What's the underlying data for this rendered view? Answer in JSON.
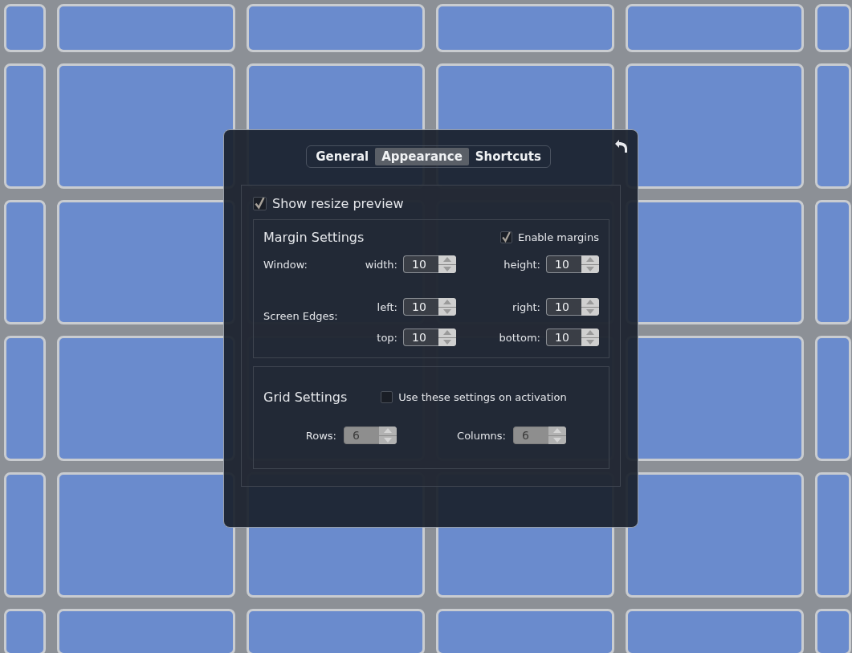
{
  "tabs": [
    {
      "label": "General",
      "selected": false
    },
    {
      "label": "Appearance",
      "selected": true
    },
    {
      "label": "Shortcuts",
      "selected": false
    }
  ],
  "show_resize_preview": {
    "label": "Show resize preview",
    "checked": true
  },
  "margin_settings": {
    "title": "Margin Settings",
    "enable_margins": {
      "label": "Enable margins",
      "checked": true
    },
    "window": {
      "label": "Window:",
      "fields": [
        {
          "label": "width:",
          "value": "10"
        },
        {
          "label": "height:",
          "value": "10"
        }
      ]
    },
    "screen_edges": {
      "label": "Screen Edges:",
      "fields": [
        {
          "label": "left:",
          "value": "10"
        },
        {
          "label": "right:",
          "value": "10"
        },
        {
          "label": "top:",
          "value": "10"
        },
        {
          "label": "bottom:",
          "value": "10"
        }
      ]
    }
  },
  "grid_settings": {
    "title": "Grid Settings",
    "use_on_activation": {
      "label": "Use these settings on activation",
      "checked": false
    },
    "fields": [
      {
        "label": "Rows:",
        "value": "6",
        "disabled": true
      },
      {
        "label": "Columns:",
        "value": "6",
        "disabled": true
      }
    ]
  }
}
